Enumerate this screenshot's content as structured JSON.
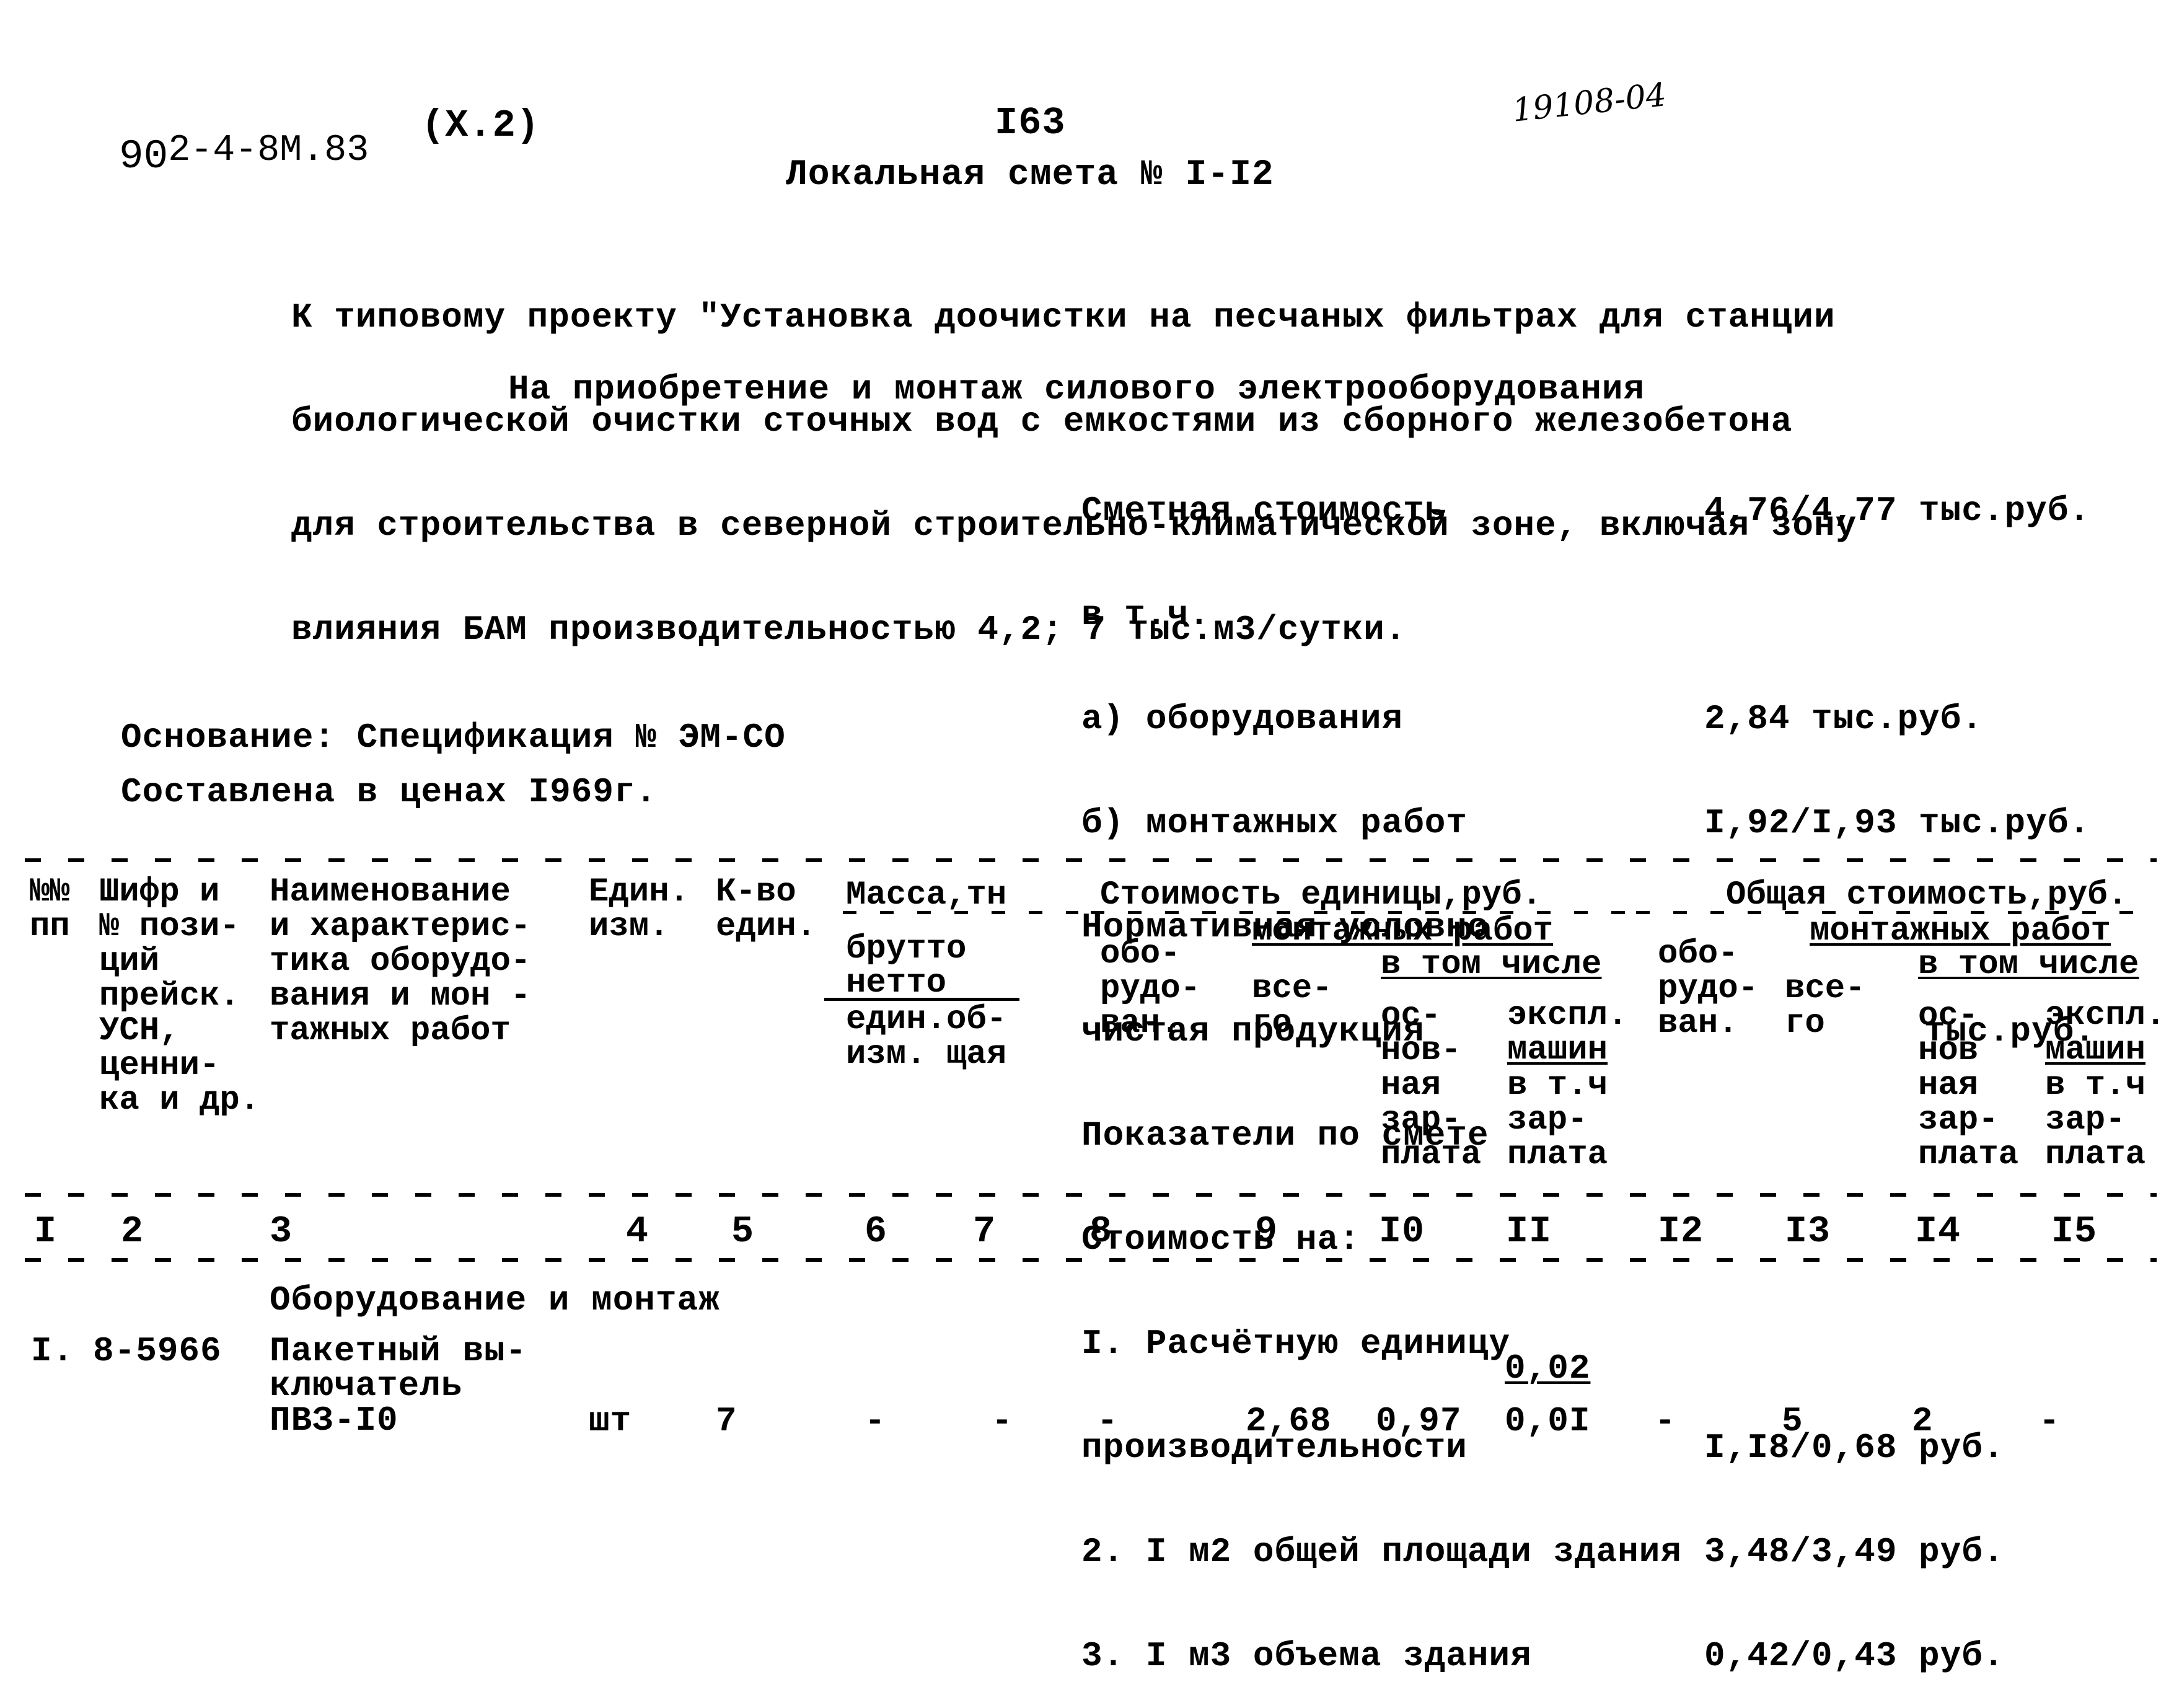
{
  "header": {
    "doc_code_prefix": "90",
    "doc_code": "2-4-8М.83",
    "volume": "(X.2)",
    "page_number": "I63",
    "handwritten_ref": "19108-04",
    "title": "Локальная смета № I-I2"
  },
  "description": {
    "lines": [
      "К типовому проекту \"Установка доочистки на песчаных фильтрах для станции",
      "биологической очистки сточных вод с емкостями из сборного железобетона",
      "для строительства в северной строительно-климатической зоне, включая зону",
      "влияния БАМ производительностью 4,2; 7 тыс.м3/сутки."
    ],
    "subtitle": "На приобретение и монтаж силового электрооборудования"
  },
  "summary": {
    "rows": [
      {
        "label": "Сметная стоимость",
        "value": "4,76/4,77 тыс.руб."
      },
      {
        "label": "в т.ч.",
        "value": ""
      },
      {
        "label": "а) оборудования",
        "value": "2,84 тыс.руб."
      },
      {
        "label": "б) монтажных работ",
        "value": "I,92/I,93 тыс.руб."
      },
      {
        "label": "Нормативная условно",
        "value": ""
      },
      {
        "label": "чистая продукция",
        "value": "тыс.руб."
      },
      {
        "label": "Показатели по смете",
        "value": ""
      },
      {
        "label": "Стоимость на:",
        "value": ""
      },
      {
        "label": "I. Расчётную единицу",
        "value": ""
      },
      {
        "label": "производительности",
        "value": "I,I8/0,68 руб."
      },
      {
        "label": "2. I м2 общей площади здания",
        "value": "3,48/3,49 руб."
      },
      {
        "label": "3. I м3 объема здания",
        "value": "0,42/0,43 руб."
      }
    ]
  },
  "basis": {
    "line1": "Основание: Спецификация № ЭМ-СО",
    "line2": "Составлена в ценах I969г."
  },
  "table": {
    "headers": {
      "c1": "№№\nпп",
      "c2": "Шифр и\n№ пози-\nций\nпрейск.\nУСН,\nценни-\nка и др.",
      "c3": "Наименование\nи характерис-\nтика оборудо-\nвания и мон -\nтажных работ",
      "c4": "Един.\nизм.",
      "c5": "К-во\nедин.",
      "mass_group": "Масса,тн",
      "mass_brutto": "брутто",
      "mass_netto": "нетто",
      "mass_unit": "един.об-\nизм. щая",
      "unit_cost_group": "Стоимость единицы,руб.",
      "unit_equipment": "обо-\nрудо-\nван.",
      "unit_install_group": "монтажных работ",
      "unit_install_total": "все-\nго",
      "unit_incl_group": "в том числе",
      "unit_base_wage": "ос-\nнов-\nная\nзар-\nплата",
      "unit_machine_top": "экспл.",
      "unit_machine_mid": "машин",
      "unit_machine_bot": "в т.ч\nзар-\nплата",
      "total_cost_group": "Общая стоимость,руб.",
      "total_equipment": "обо-\nрудо-\nван.",
      "total_install_group": "монтажных работ",
      "total_install_total": "все-\nго",
      "total_incl_group": "в том числе",
      "total_base_wage": "ос-\nнов\nная\nзар-\nплата",
      "total_machine_top": "экспл.",
      "total_machine_mid": "машин",
      "total_machine_bot": "в т.ч\nзар-\nплата"
    },
    "column_numbers": [
      "I",
      "2",
      "3",
      "4",
      "5",
      "6",
      "7",
      "8",
      "9",
      "I0",
      "II",
      "I2",
      "I3",
      "I4",
      "I5"
    ],
    "section_title": "Оборудование и монтаж",
    "rows": [
      {
        "num": "I.",
        "code": "8-5966",
        "name": "Пакетный вы-\nключатель\nПВЗ-I0",
        "unit": "шт",
        "qty": "7",
        "mass_unit": "-",
        "mass_total": "-",
        "unit_equipment": "-",
        "unit_install_total": "2,68",
        "unit_base_wage": "0,97",
        "unit_machine": "0,0I",
        "unit_machine_wage": "0,02",
        "total_equipment": "-",
        "total_install_total": "5",
        "total_base_wage": "2",
        "total_machine": "-"
      }
    ]
  }
}
